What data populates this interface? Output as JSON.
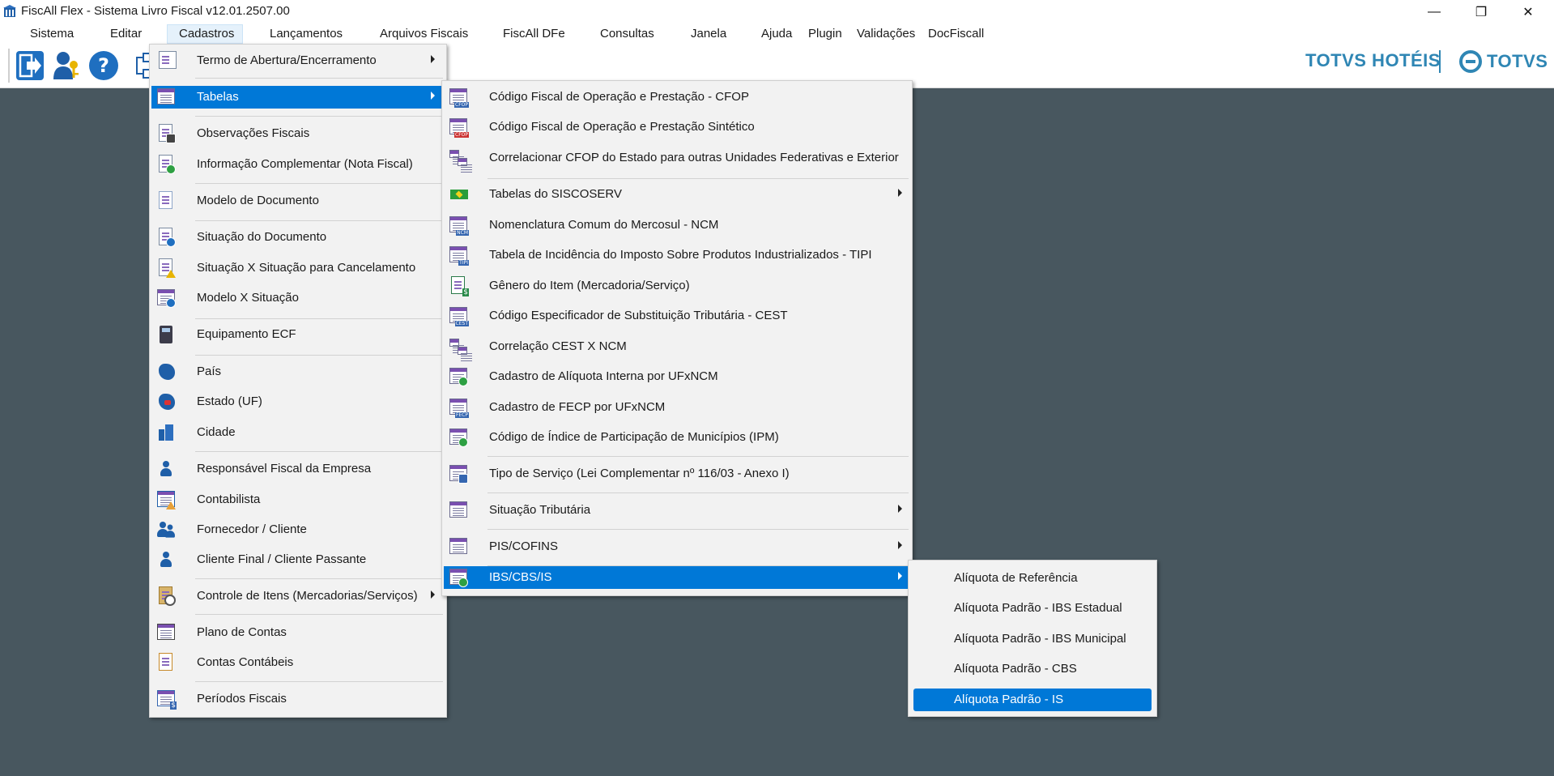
{
  "window": {
    "title": "FiscAll Flex - Sistema Livro Fiscal v12.01.2507.00",
    "minimize": "—",
    "restore": "❐",
    "close": "✕"
  },
  "menubar": [
    "Sistema",
    "Editar",
    "Cadastros",
    "Lançamentos",
    "Arquivos Fiscais",
    "FiscAll DFe",
    "Consultas",
    "Janela",
    "Ajuda",
    "Plugin",
    "Validações",
    "DocFiscall"
  ],
  "brand": {
    "left": "TOTVS HOTÉIS",
    "right": "TOTVS",
    "color": "#2f86b4"
  },
  "cadastros_menu": [
    {
      "label": "Termo de Abertura/Encerramento",
      "icon": "book-icon",
      "submenu": true
    },
    {
      "label": "Tabelas",
      "icon": "table-icon",
      "submenu": true,
      "highlighted": true
    },
    {
      "label": "Observações Fiscais",
      "icon": "document-lock-icon"
    },
    {
      "label": "Informação Complementar (Nota Fiscal)",
      "icon": "document-add-icon"
    },
    {
      "label": "Modelo de Documento",
      "icon": "document-icon"
    },
    {
      "label": "Situação do Documento",
      "icon": "document-info-icon"
    },
    {
      "label": "Situação X Situação para Cancelamento",
      "icon": "document-warning-icon"
    },
    {
      "label": "Modelo X Situação",
      "icon": "table-info-icon"
    },
    {
      "label": "Equipamento ECF",
      "icon": "cash-register-icon"
    },
    {
      "label": "País",
      "icon": "country-map-icon"
    },
    {
      "label": "Estado (UF)",
      "icon": "state-map-icon"
    },
    {
      "label": "Cidade",
      "icon": "city-buildings-icon"
    },
    {
      "label": "Responsável Fiscal da Empresa",
      "icon": "person-icon"
    },
    {
      "label": "Contabilista",
      "icon": "accountant-icon"
    },
    {
      "label": "Fornecedor / Cliente",
      "icon": "people-icon"
    },
    {
      "label": "Cliente Final / Cliente Passante",
      "icon": "person-icon"
    },
    {
      "label": "Controle de Itens (Mercadorias/Serviços)",
      "icon": "items-clock-icon",
      "submenu": true
    },
    {
      "label": "Plano de Contas",
      "icon": "chart-accounts-icon"
    },
    {
      "label": "Contas Contábeis",
      "icon": "ledger-icon"
    },
    {
      "label": "Períodos Fiscais",
      "icon": "calendar-money-icon"
    }
  ],
  "tabelas_menu": [
    {
      "label": "Código Fiscal de Operação e Prestação - CFOP",
      "icon": "cfop-table-icon",
      "tag": "CFOP"
    },
    {
      "label": "Código Fiscal de Operação e Prestação Sintético",
      "icon": "cfop-synthetic-icon",
      "tag": "CFOP"
    },
    {
      "label": "Correlacionar CFOP do Estado para outras Unidades Federativas e Exterior",
      "icon": "correlation-icon"
    },
    {
      "label": "Tabelas do SISCOSERV",
      "icon": "brazil-flag-icon",
      "submenu": true
    },
    {
      "label": "Nomenclatura Comum do Mercosul  - NCM",
      "icon": "ncm-table-icon",
      "tag": "NCM"
    },
    {
      "label": "Tabela de Incidência do Imposto Sobre Produtos Industrializados - TIPI",
      "icon": "tipi-table-icon",
      "tag": "TIPI"
    },
    {
      "label": "Gênero do Item (Mercadoria/Serviço)",
      "icon": "money-document-icon"
    },
    {
      "label": "Código Especificador de Substituição Tributária - CEST",
      "icon": "cest-table-icon",
      "tag": "CEST"
    },
    {
      "label": "Correlação CEST X NCM",
      "icon": "correlation-icon"
    },
    {
      "label": "Cadastro de Alíquota Interna por UFxNCM",
      "icon": "percent-table-icon"
    },
    {
      "label": "Cadastro de FECP por UFxNCM",
      "icon": "fecp-table-icon",
      "tag": "FECP"
    },
    {
      "label": "Código de Índice de Participação de Municípios (IPM)",
      "icon": "table-add-icon"
    },
    {
      "label": "Tipo de Serviço (Lei Complementar nº 116/03 - Anexo I)",
      "icon": "service-tools-icon"
    },
    {
      "label": "Situação Tributária",
      "icon": "table-icon",
      "submenu": true
    },
    {
      "label": "PIS/COFINS",
      "icon": "table-icon",
      "submenu": true
    },
    {
      "label": "IBS/CBS/IS",
      "icon": "tax-table-icon",
      "submenu": true,
      "highlighted": true
    }
  ],
  "ibs_menu": [
    {
      "label": "Alíquota de Referência"
    },
    {
      "label": "Alíquota Padrão - IBS Estadual"
    },
    {
      "label": "Alíquota Padrão - IBS Municipal"
    },
    {
      "label": "Alíquota Padrão - CBS"
    },
    {
      "label": "Alíquota Padrão - IS",
      "highlighted": true
    }
  ],
  "colors": {
    "highlight": "#0078d7",
    "desktop": "#48575f"
  }
}
